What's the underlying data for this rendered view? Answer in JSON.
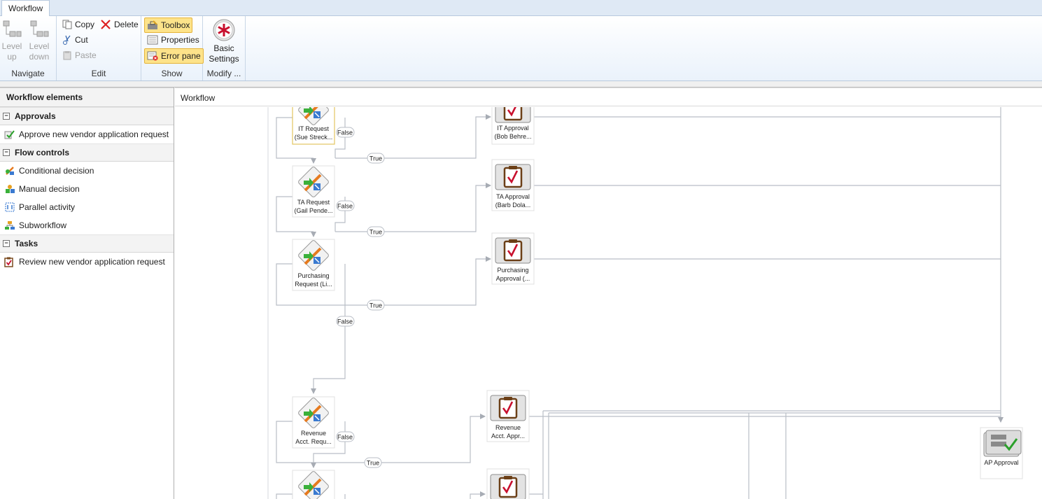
{
  "tabs": {
    "workflow": "Workflow"
  },
  "ribbon": {
    "navigate": {
      "label": "Navigate",
      "level_up": "Level up",
      "level_down": "Level down"
    },
    "edit": {
      "label": "Edit",
      "copy": "Copy",
      "delete": "Delete",
      "cut": "Cut",
      "paste": "Paste"
    },
    "show": {
      "label": "Show",
      "toolbox": "Toolbox",
      "properties": "Properties",
      "error_pane": "Error pane"
    },
    "modify": {
      "label": "Modify ...",
      "basic_settings": "Basic Settings"
    }
  },
  "left_panel": {
    "title": "Workflow elements",
    "categories": [
      {
        "name": "Approvals",
        "items": [
          {
            "label": "Approve new vendor application request",
            "icon": "approval-icon"
          }
        ]
      },
      {
        "name": "Flow controls",
        "items": [
          {
            "label": "Conditional decision",
            "icon": "conditional-decision-icon"
          },
          {
            "label": "Manual decision",
            "icon": "manual-decision-icon"
          },
          {
            "label": "Parallel activity",
            "icon": "parallel-activity-icon"
          },
          {
            "label": "Subworkflow",
            "icon": "subworkflow-icon"
          }
        ]
      },
      {
        "name": "Tasks",
        "items": [
          {
            "label": "Review new vendor application request",
            "icon": "task-icon"
          }
        ]
      }
    ]
  },
  "canvas": {
    "title": "Workflow",
    "edge_labels": {
      "true": "True",
      "false": "False"
    },
    "decisions": [
      {
        "line1": "IT Request",
        "line2": "(Sue Streck..."
      },
      {
        "line1": "TA Request",
        "line2": "(Gail Pende..."
      },
      {
        "line1": "Purchasing",
        "line2": "Request (Li..."
      },
      {
        "line1": "Revenue",
        "line2": "Acct. Requ..."
      }
    ],
    "approvals": [
      {
        "line1": "IT Approval",
        "line2": "(Bob Behre..."
      },
      {
        "line1": "TA Approval",
        "line2": "(Barb Dola..."
      },
      {
        "line1": "Purchasing",
        "line2": "Approval (..."
      },
      {
        "line1": "Revenue",
        "line2": "Acct. Appr..."
      }
    ],
    "final_approval": "AP Approval"
  },
  "colors": {
    "ribbon_bg": "#eaf2fb",
    "active_toggle": "#fde38a",
    "connector": "#b9bec6",
    "check_red": "#c8102e"
  }
}
